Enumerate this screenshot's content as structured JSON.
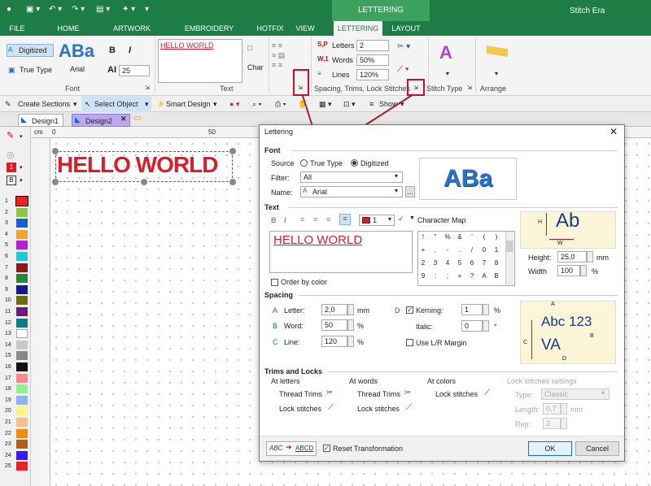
{
  "app": {
    "title": "Stitch Era",
    "context_group": "LETTERING"
  },
  "ribbon_tabs": [
    "FILE",
    "HOME",
    "ARTWORK",
    "EMBROIDERY",
    "HOTFIX",
    "VIEW",
    "LETTERING",
    "LAYOUT"
  ],
  "ribbon": {
    "font": {
      "digitized": "Digitized",
      "true_type": "True Type",
      "preview": "ABa",
      "font_name": "Arial",
      "bold": "B",
      "italic": "I",
      "size_label": "AI",
      "size": "25",
      "group_label": "Font"
    },
    "text": {
      "value": "HELLO WORLD",
      "char_label": "Char",
      "group_label": "Text"
    },
    "spacing": {
      "letters_label": "Letters",
      "letters": "2",
      "words_label": "Words",
      "words": "50%",
      "lines_label": "Lines",
      "lines": "120%",
      "group_label": "Spacing, Trims, Lock Stitches"
    },
    "stitch_type_label": "Stitch Type",
    "arrange_label": "Arrange"
  },
  "toolbar": {
    "create_sections": "Create Sections",
    "select_object": "Select Object",
    "smart_design": "Smart Design",
    "show": "Show"
  },
  "doc_tabs": [
    "Design1",
    "Design2"
  ],
  "ruler": {
    "unit": "cm",
    "ticks": [
      "0",
      "50"
    ]
  },
  "canvas": {
    "text": "HELLO WORLD",
    "text_color": "#d81e2c"
  },
  "palette": {
    "indicator_1": "1",
    "indicator_2": "B",
    "items": [
      {
        "n": "1",
        "c": "#e8232a"
      },
      {
        "n": "2",
        "c": "#8bc34a"
      },
      {
        "n": "3",
        "c": "#1a5fd0"
      },
      {
        "n": "4",
        "c": "#f6a623"
      },
      {
        "n": "5",
        "c": "#b21fd6"
      },
      {
        "n": "6",
        "c": "#1fcad6"
      },
      {
        "n": "7",
        "c": "#8a1a1a"
      },
      {
        "n": "8",
        "c": "#1f8a3a"
      },
      {
        "n": "9",
        "c": "#151a8a"
      },
      {
        "n": "10",
        "c": "#6b6b1a"
      },
      {
        "n": "11",
        "c": "#6b1a7a"
      },
      {
        "n": "12",
        "c": "#0f7a80"
      },
      {
        "n": "13",
        "c": "#ffffff"
      },
      {
        "n": "14",
        "c": "#c8c8c8"
      },
      {
        "n": "15",
        "c": "#888888"
      },
      {
        "n": "16",
        "c": "#111111"
      },
      {
        "n": "17",
        "c": "#f58a8a"
      },
      {
        "n": "18",
        "c": "#8af58a"
      },
      {
        "n": "19",
        "c": "#8ab4f5"
      },
      {
        "n": "20",
        "c": "#f5f58a"
      },
      {
        "n": "21",
        "c": "#f5c08a"
      },
      {
        "n": "22",
        "c": "#f58a1a"
      },
      {
        "n": "23",
        "c": "#b25e1a"
      },
      {
        "n": "24",
        "c": "#3a1af5"
      },
      {
        "n": "25",
        "c": "#e8232a"
      }
    ]
  },
  "dialog": {
    "title": "Lettering",
    "font": {
      "section": "Font",
      "source_label": "Source",
      "true_type": "True Type",
      "digitized": "Digitized",
      "filter_label": "Filter:",
      "filter": "All",
      "name_label": "Name:",
      "name": "Arial",
      "browse": "...",
      "preview": "ABa"
    },
    "text": {
      "section": "Text",
      "bold": "B",
      "italic": "I",
      "color_index": "1",
      "color": "#d81e2c",
      "char_map": "Character Map",
      "value": "HELLO WORLD",
      "order_by_color": "Order by color",
      "chars": [
        "!",
        "\"",
        "%",
        "&",
        "'",
        "(",
        ")",
        "+",
        ",",
        "-",
        ".",
        "/",
        "0",
        "1",
        "2",
        "3",
        "4",
        "5",
        "6",
        "7",
        "8",
        "9",
        ":",
        ";",
        "=",
        "?",
        "A",
        "B"
      ],
      "height_label": "Height:",
      "height": "25,0",
      "height_unit": "mm",
      "width_label": "Width",
      "width": "100",
      "width_unit": "%",
      "preview_sample": "Ab",
      "preview_h": "H",
      "preview_w": "W"
    },
    "spacing": {
      "section": "Spacing",
      "letter_label": "Letter:",
      "letter": "2,0",
      "letter_unit": "mm",
      "letter_marker": "A",
      "word_label": "Word:",
      "word": "50",
      "word_unit": "%",
      "word_marker": "B",
      "line_label": "Line:",
      "line": "120",
      "line_unit": "%",
      "line_marker": "C",
      "kerning_marker": "D",
      "kerning_label": "Kerning:",
      "kerning": "1",
      "kerning_unit": "%",
      "italic_label": "Italic:",
      "italic": "0",
      "italic_unit": "°",
      "use_lr": "Use L/R Margin",
      "preview_top": "Abc 123",
      "preview_bottom": "VA",
      "preview_a": "A",
      "preview_b": "B",
      "preview_c": "C",
      "preview_d": "D"
    },
    "trims": {
      "section": "Trims and Locks",
      "at_letters": "At letters",
      "at_words": "At words",
      "at_colors": "At colors",
      "thread_trims": "Thread Trims",
      "lock_stitches": "Lock stitches",
      "lock_settings": "Lock stitches settings",
      "type_label": "Type:",
      "type": "Classic",
      "length_label": "Length:",
      "length": "0,7",
      "length_unit": "mm",
      "rep_label": "Rep:",
      "rep": "2"
    },
    "footer": {
      "transform_from": "ABC",
      "transform_to": "ABCD",
      "reset": "Reset Transformation",
      "ok": "OK",
      "cancel": "Cancel"
    }
  }
}
